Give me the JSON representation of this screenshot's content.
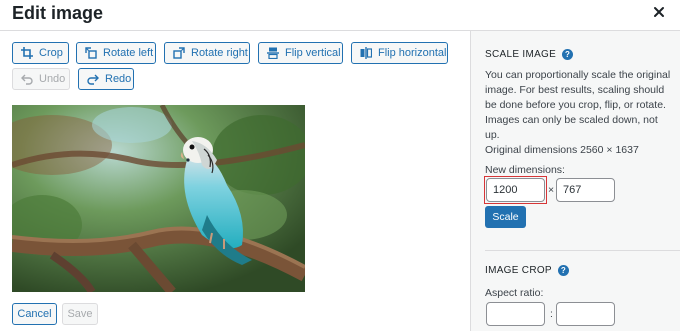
{
  "dialog": {
    "title": "Edit image"
  },
  "toolbar": {
    "crop": "Crop",
    "rotate_left": "Rotate left",
    "rotate_right": "Rotate right",
    "flip_vertical": "Flip vertical",
    "flip_horizontal": "Flip horizontal",
    "undo": "Undo",
    "redo": "Redo"
  },
  "actions": {
    "cancel": "Cancel",
    "save": "Save"
  },
  "scale": {
    "heading": "SCALE IMAGE",
    "description": "You can proportionally scale the original image. For best results, scaling should be done before you crop, flip, or rotate. Images can only be scaled down, not up.",
    "original_dimensions": "Original dimensions 2560 × 1637",
    "new_dimensions_label": "New dimensions:",
    "width_value": "1200",
    "height_value": "767",
    "separator": "×",
    "button": "Scale"
  },
  "crop": {
    "heading": "IMAGE CROP",
    "aspect_ratio_label": "Aspect ratio:",
    "ratio_separator": ":"
  },
  "colors": {
    "accent": "#2271b1",
    "focus_outline": "#d63638"
  },
  "icons": {
    "close": "close-icon",
    "crop": "crop-icon",
    "rotate_left": "rotate-left-icon",
    "rotate_right": "rotate-right-icon",
    "flip_vertical": "flip-vertical-icon",
    "flip_horizontal": "flip-horizontal-icon",
    "undo": "undo-icon",
    "redo": "redo-icon",
    "help": "help-icon"
  }
}
